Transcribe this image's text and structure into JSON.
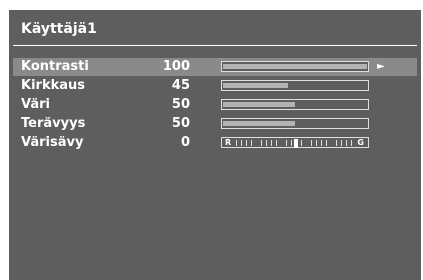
{
  "menu": {
    "title": "Käyttäjä1",
    "items": [
      {
        "label": "Kontrasti",
        "value": "100",
        "level": 100,
        "selected": true
      },
      {
        "label": "Kirkkaus",
        "value": "45",
        "level": 45,
        "selected": false
      },
      {
        "label": "Väri",
        "value": "50",
        "level": 50,
        "selected": false
      },
      {
        "label": "Terävyys",
        "value": "50",
        "level": 50,
        "selected": false
      },
      {
        "label": "Värisävy",
        "value": "0",
        "level": 0,
        "selected": false
      }
    ],
    "hue_left_label": "R",
    "hue_right_label": "G",
    "selected_arrow_icon": "play-arrow-icon"
  },
  "colors": {
    "panel_background": "#5e5e5e",
    "highlight": "#8a8a8a",
    "text": "#ffffff",
    "bar_fill": "#b3b3b3"
  }
}
